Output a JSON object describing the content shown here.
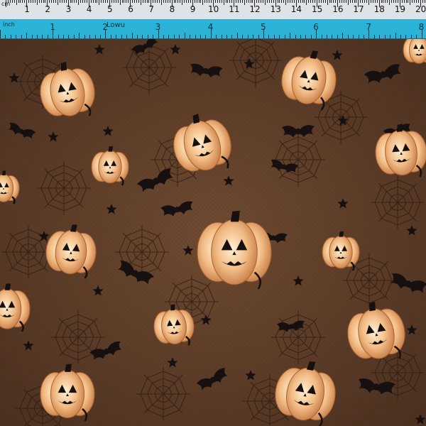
{
  "ruler": {
    "top_unit": "cm",
    "bottom_unit": "inch",
    "cm_labels": [
      "1",
      "2",
      "3",
      "4",
      "5",
      "6",
      "7",
      "8",
      "9",
      "10",
      "11",
      "12",
      "13",
      "14",
      "15",
      "16",
      "17",
      "18",
      "19",
      "20"
    ],
    "inch_labels": [
      "1",
      "2",
      "3",
      "4",
      "5",
      "6",
      "7",
      "8"
    ],
    "handwritten": "Lowu",
    "color_top": "#dfe2e6",
    "color_bottom": "#2ab3d6"
  },
  "fabric": {
    "background": "#5a3c26",
    "pumpkin_color": "#f0b77a",
    "pumpkin_shadow": "#c98450",
    "motif_color": "#171010"
  }
}
